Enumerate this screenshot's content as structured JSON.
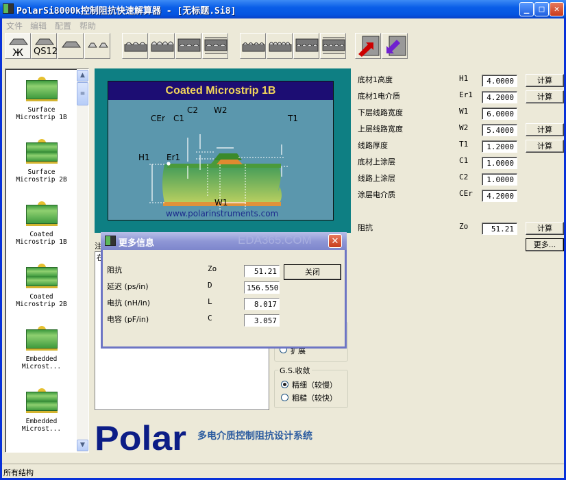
{
  "window": {
    "title": "PolarSi8000k控制阻抗快速解算器 - [无标题.Si8]",
    "min": "_",
    "max": "□",
    "close": "✕"
  },
  "menu": [
    "文件",
    "编辑",
    "配置",
    "帮助"
  ],
  "toolbar": {
    "first_labels": [
      "Ж",
      "QS12"
    ]
  },
  "sidebar": {
    "items": [
      {
        "line1": "Surface",
        "line2": "Microstrip 1B"
      },
      {
        "line1": "Surface",
        "line2": "Microstrip 2B"
      },
      {
        "line1": "Coated",
        "line2": "Microstrip 1B"
      },
      {
        "line1": "Coated",
        "line2": "Microstrip 2B"
      },
      {
        "line1": "Embedded",
        "line2": "Microst..."
      },
      {
        "line1": "Embedded",
        "line2": "Microst..."
      }
    ]
  },
  "diagram": {
    "title": "Coated Microstrip 1B",
    "labels": {
      "cer": "CEr",
      "c1": "C1",
      "c2": "C2",
      "w2": "W2",
      "t1": "T1",
      "h1": "H1",
      "er1": "Er1",
      "w1": "W1"
    },
    "url": "www.polarinstruments.com"
  },
  "params": [
    {
      "label": "底材1高度",
      "sym": "H1",
      "value": "4.0000",
      "button": "计算"
    },
    {
      "label": "底材1电介质",
      "sym": "Er1",
      "value": "4.2000",
      "button": "计算"
    },
    {
      "label": "下层线路宽度",
      "sym": "W1",
      "value": "6.0000"
    },
    {
      "label": "上层线路宽度",
      "sym": "W2",
      "value": "5.4000",
      "button": "计算"
    },
    {
      "label": "线路厚度",
      "sym": "T1",
      "value": "1.2000",
      "button": "计算"
    },
    {
      "label": "底材上涂层",
      "sym": "C1",
      "value": "1.0000"
    },
    {
      "label": "线路上涂层",
      "sym": "C2",
      "value": "1.0000"
    },
    {
      "label": "涂层电介质",
      "sym": "CEr",
      "value": "4.2000"
    }
  ],
  "impedance": {
    "label": "阻抗",
    "sym": "Zo",
    "value": "51.21",
    "button": "计算",
    "more": "更多..."
  },
  "notes": {
    "label": "注",
    "text": "在"
  },
  "options": {
    "partial_radio": "扩展",
    "gs_title": "G.S.收敛",
    "fine": "精细（较慢）",
    "coarse": "粗糙（较快）"
  },
  "dialog": {
    "title": "更多信息",
    "watermark": "EDA365.COM",
    "close_button": "关闭",
    "rows": [
      {
        "label": "阻抗",
        "sym": "Zo",
        "value": "51.21"
      },
      {
        "label": "延迟 (ps/in)",
        "sym": "D",
        "value": "156.550"
      },
      {
        "label": "电抗 (nH/in)",
        "sym": "L",
        "value": "8.017"
      },
      {
        "label": "电容 (pF/in)",
        "sym": "C",
        "value": "3.057"
      }
    ]
  },
  "brand": {
    "logo": "Polar",
    "slogan": "多电介质控制阻抗设计系统"
  },
  "status": "所有结构"
}
